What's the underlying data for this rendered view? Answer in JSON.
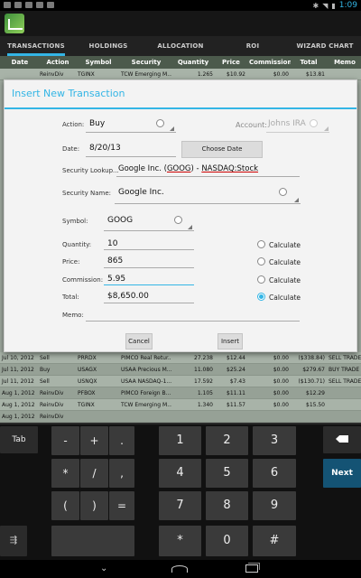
{
  "status_bar": {
    "time": "1:09"
  },
  "tabs": [
    {
      "label": "TRANSACTIONS",
      "active": true
    },
    {
      "label": "HOLDINGS",
      "active": false
    },
    {
      "label": "ALLOCATION",
      "active": false
    },
    {
      "label": "ROI",
      "active": false
    },
    {
      "label": "WIZARD CHART",
      "active": false
    }
  ],
  "table": {
    "headers": [
      "Date",
      "Action",
      "Symbol",
      "Security",
      "Quantity",
      "Price",
      "Commission",
      "Total",
      "Memo"
    ],
    "top_row": [
      "",
      "ReinvDiv",
      "TGINX",
      "TCW Emerging M...",
      "1.265",
      "$10.92",
      "$0.00",
      "$13.81",
      ""
    ],
    "rows": [
      [
        "Jul 10, 2012",
        "Sell",
        "PRRDX",
        "PIMCO Real Retur...",
        "27.238",
        "$12.44",
        "$0.00",
        "($338.84)",
        "SELL TRADE"
      ],
      [
        "Jul 11, 2012",
        "Buy",
        "USAGX",
        "USAA Precious M...",
        "11.080",
        "$25.24",
        "$0.00",
        "$279.67",
        "BUY TRADE"
      ],
      [
        "Jul 11, 2012",
        "Sell",
        "USNQX",
        "USAA NASDAQ-1...",
        "17.592",
        "$7.43",
        "$0.00",
        "($130.71)",
        "SELL TRADE"
      ],
      [
        "Aug 1, 2012",
        "ReinvDiv",
        "PFBOX",
        "PIMCO Foreign B...",
        "1.105",
        "$11.11",
        "$0.00",
        "$12.29",
        ""
      ],
      [
        "Aug 1, 2012",
        "ReinvDiv",
        "TGINX",
        "TCW Emerging M...",
        "1.340",
        "$11.57",
        "$0.00",
        "$15.50",
        ""
      ],
      [
        "Aug 1, 2012",
        "ReinvDiv",
        "",
        "",
        "",
        "",
        "",
        "",
        ""
      ]
    ]
  },
  "dialog": {
    "title": "Insert New Transaction",
    "action_label": "Action:",
    "action_value": "Buy",
    "account_label": "Account:",
    "account_value": "Johns IRA",
    "date_label": "Date:",
    "date_value": "8/20/13",
    "choose_date_label": "Choose Date",
    "security_lookup_label": "Security Lookup...",
    "security_lookup_value_a": "Google Inc. (",
    "security_lookup_value_b": "GOOG",
    "security_lookup_value_c": ")  -  ",
    "security_lookup_value_d": "NASDAQ:Stock",
    "security_name_label": "Security Name:",
    "security_name_value": "Google Inc.",
    "symbol_label": "Symbol:",
    "symbol_value": "GOOG",
    "quantity_label": "Quantity:",
    "quantity_value": "10",
    "price_label": "Price:",
    "price_value": "865",
    "commission_label": "Commission:",
    "commission_value": "5.95",
    "total_label": "Total:",
    "total_value": "$8,650.00",
    "memo_label": "Memo:",
    "calculate_label": "Calculate",
    "calculate_selected": "total",
    "cancel_label": "Cancel",
    "insert_label": "Insert"
  },
  "keyboard": {
    "tab": "Tab",
    "minus": "-",
    "plus": "+",
    "dot": ".",
    "star": "*",
    "slash": "/",
    "comma": ",",
    "lparen": "(",
    "rparen": ")",
    "equals": "=",
    "k1": "1",
    "k2": "2",
    "k3": "3",
    "k4": "4",
    "k5": "5",
    "k6": "6",
    "k7": "7",
    "k8": "8",
    "k9": "9",
    "kstar": "*",
    "k0": "0",
    "khash": "#",
    "next": "Next",
    "settings_icon": "sliders-icon",
    "delete_icon": "backspace-icon"
  },
  "colors": {
    "accent": "#33b5e5",
    "next_key": "#145374"
  }
}
